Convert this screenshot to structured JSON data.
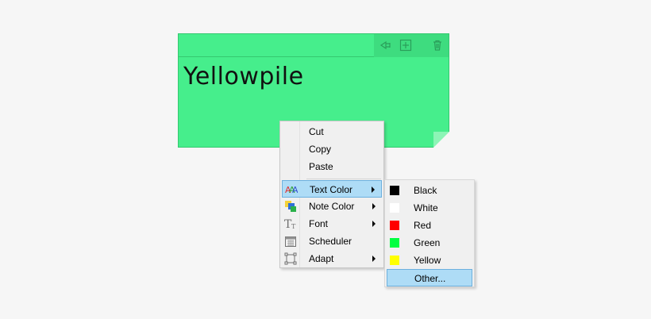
{
  "note": {
    "title": "Yellowpile",
    "background": "#46ee8c"
  },
  "toolbar": {
    "icons": [
      "pin-icon",
      "add-note-icon",
      "trash-icon"
    ]
  },
  "context_menu": {
    "items": [
      {
        "label": "Cut"
      },
      {
        "label": "Copy"
      },
      {
        "label": "Paste"
      },
      {
        "label": "Text Color",
        "icon": "text-color-icon",
        "submenu": true,
        "highlighted": true
      },
      {
        "label": "Note Color",
        "icon": "note-color-icon",
        "submenu": true
      },
      {
        "label": "Font",
        "icon": "font-icon",
        "submenu": true
      },
      {
        "label": "Scheduler",
        "icon": "calendar-icon"
      },
      {
        "label": "Adapt",
        "icon": "adapt-icon",
        "submenu": true
      }
    ]
  },
  "color_submenu": {
    "items": [
      {
        "label": "Black",
        "color": "#000000"
      },
      {
        "label": "White",
        "color": "#ffffff"
      },
      {
        "label": "Red",
        "color": "#ff0000"
      },
      {
        "label": "Green",
        "color": "#00ff40"
      },
      {
        "label": "Yellow",
        "color": "#ffff00"
      },
      {
        "label": "Other...",
        "highlighted": true
      }
    ]
  }
}
